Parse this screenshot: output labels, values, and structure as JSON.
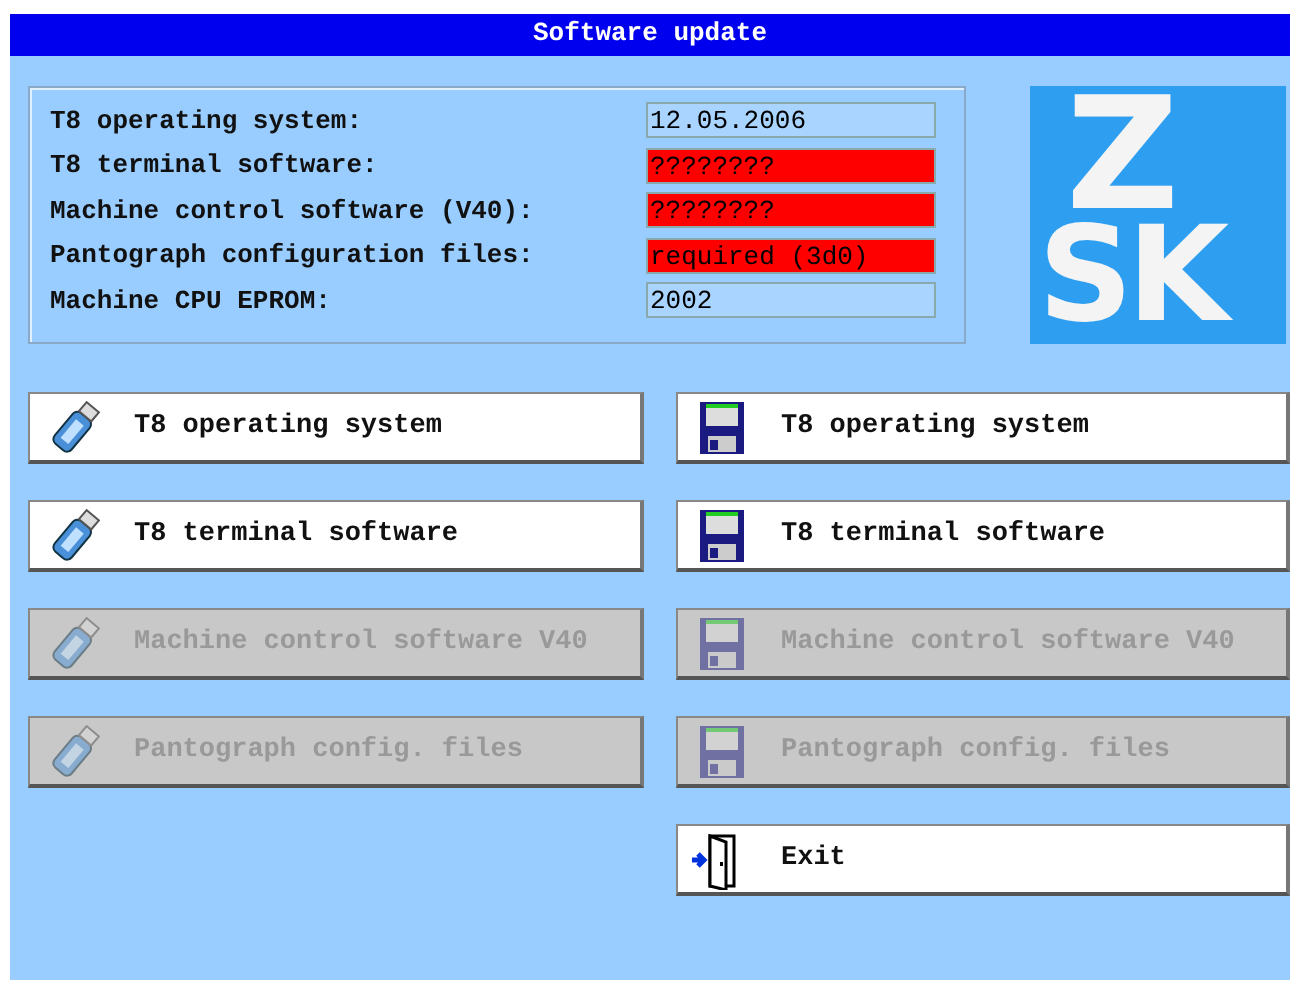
{
  "window": {
    "title": "Software update"
  },
  "versions": [
    {
      "label": "T8 operating system:",
      "value": "12.05.2006",
      "color": "#a8d4ff"
    },
    {
      "label": "T8 terminal software:",
      "value": "????????",
      "color": "#ff0000"
    },
    {
      "label": "Machine control software (V40):",
      "value": "????????",
      "color": "#ff0000"
    },
    {
      "label": "Pantograph configuration files:",
      "value": "required (3d0)",
      "color": "#ff0000"
    },
    {
      "label": "Machine CPU EPROM:",
      "value": "2002",
      "color": "#a8d4ff"
    }
  ],
  "logo": {
    "lines": [
      "Z",
      "SK"
    ]
  },
  "usb_buttons": [
    {
      "label": "T8 operating system",
      "disabled": false
    },
    {
      "label": "T8 terminal software",
      "disabled": false
    },
    {
      "label": "Machine control software V40",
      "disabled": true
    },
    {
      "label": "Pantograph config. files",
      "disabled": true
    }
  ],
  "disk_buttons": [
    {
      "label": "T8 operating system",
      "disabled": false
    },
    {
      "label": "T8 terminal software",
      "disabled": false
    },
    {
      "label": "Machine control software V40",
      "disabled": true
    },
    {
      "label": "Pantograph config. files",
      "disabled": true
    }
  ],
  "exit_button": {
    "label": "Exit"
  }
}
